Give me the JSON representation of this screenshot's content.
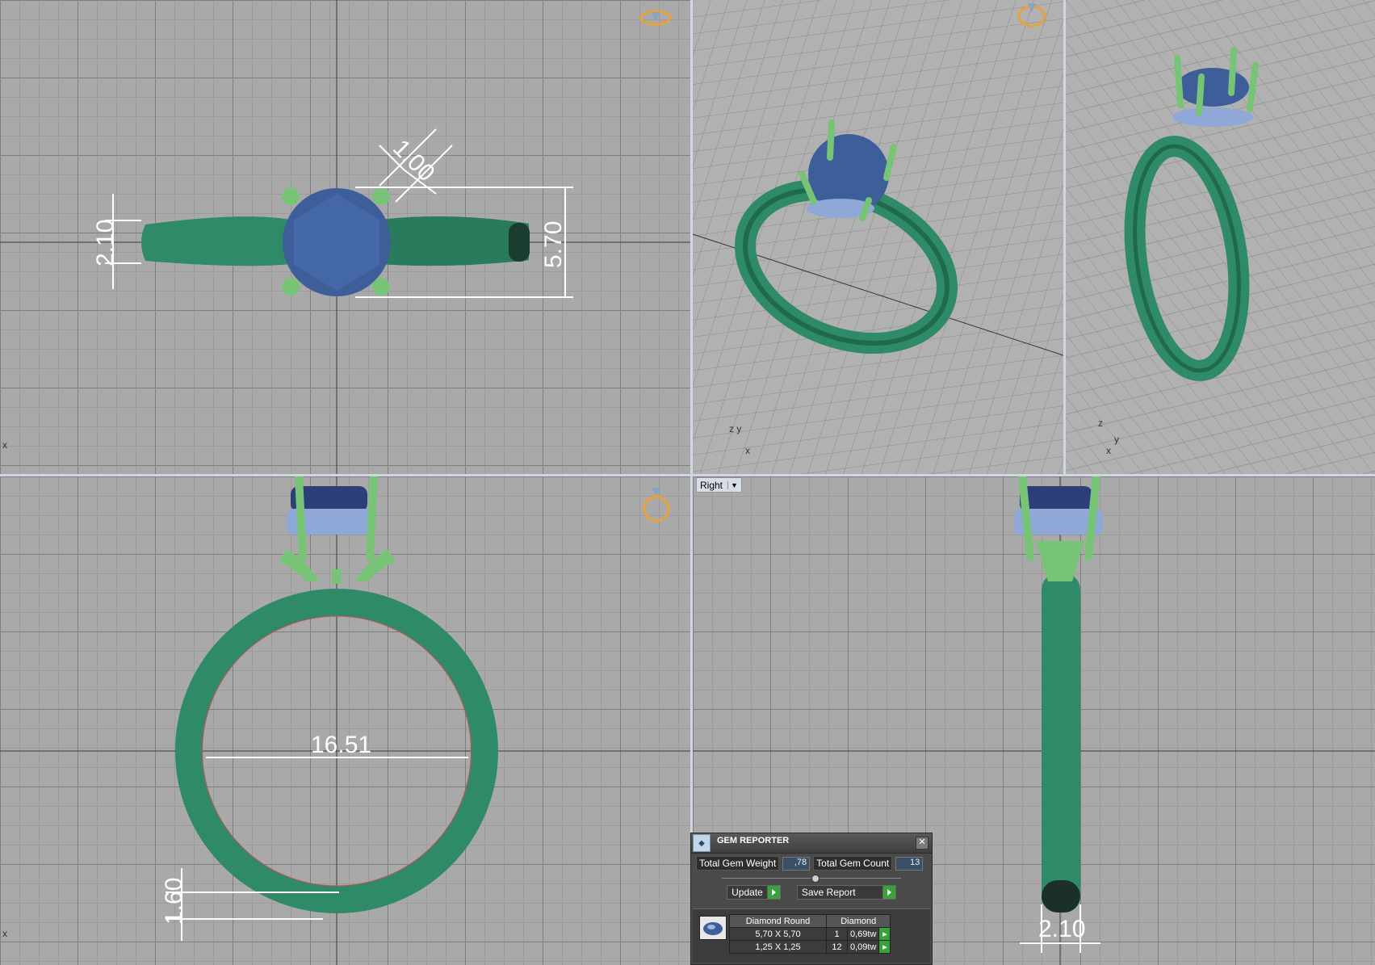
{
  "viewports": {
    "right": {
      "view_label": "Right"
    }
  },
  "dimensions": {
    "top_prong_width": "1.00",
    "top_shank_width": "2.10",
    "top_stone_diameter": "5.70",
    "front_ring_inner_diameter": "16.51",
    "front_shank_thickness": "1.60",
    "right_shank_width": "2.10"
  },
  "gem_reporter": {
    "title": "GEM REPORTER",
    "total_gem_weight_label": "Total Gem Weight",
    "total_gem_weight": ",78",
    "total_gem_count_label": "Total Gem Count",
    "total_gem_count": "13",
    "update_label": "Update",
    "save_report_label": "Save Report",
    "columns": [
      "Diamond Round",
      "Diamond"
    ],
    "rows": [
      {
        "size": "5,70 X 5,70",
        "count": "1",
        "weight": "0,69tw"
      },
      {
        "size": "1,25 X 1,25",
        "count": "12",
        "weight": "0,09tw"
      }
    ]
  },
  "colors": {
    "metal": "#2f8a68",
    "stone": "#3e5e9a",
    "prong": "#78c476",
    "dimension": "#ffffff"
  },
  "icons": [
    "top-view-ring-icon",
    "perspective-ring-icon",
    "front-view-ring-icon",
    "close-icon",
    "gem-reporter-logo-icon",
    "diamond-icon"
  ]
}
